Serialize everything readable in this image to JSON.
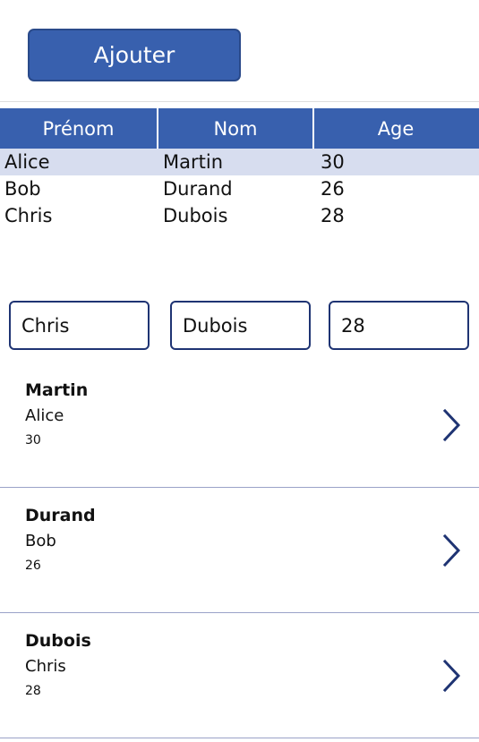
{
  "toolbar": {
    "add_label": "Ajouter"
  },
  "grid": {
    "columns": [
      "Prénom",
      "Nom",
      "Age"
    ],
    "rows": [
      {
        "prenom": "Alice",
        "nom": "Martin",
        "age": "30",
        "selected": true
      },
      {
        "prenom": "Bob",
        "nom": "Durand",
        "age": "26",
        "selected": false
      },
      {
        "prenom": "Chris",
        "nom": "Dubois",
        "age": "28",
        "selected": false
      }
    ]
  },
  "form": {
    "fields": [
      {
        "name": "prenom",
        "value": "Chris",
        "placeholder": ""
      },
      {
        "name": "nom",
        "value": "Dubois",
        "placeholder": ""
      },
      {
        "name": "age",
        "value": "28",
        "placeholder": ""
      }
    ]
  },
  "list": {
    "items": [
      {
        "title": "Martin",
        "subtitle": "Alice",
        "meta": "30",
        "chevron": "chevron-right-icon"
      },
      {
        "title": "Durand",
        "subtitle": "Bob",
        "meta": "26",
        "chevron": "chevron-right-icon"
      },
      {
        "title": "Dubois",
        "subtitle": "Chris",
        "meta": "28",
        "chevron": "chevron-right-icon"
      }
    ]
  },
  "colors": {
    "accent": "#3860ae",
    "accent_border": "#2a4a8a",
    "row_selected": "#d7ddef",
    "input_border": "#1f3473",
    "divider": "#9aa2c8",
    "chevron": "#1f3473"
  }
}
